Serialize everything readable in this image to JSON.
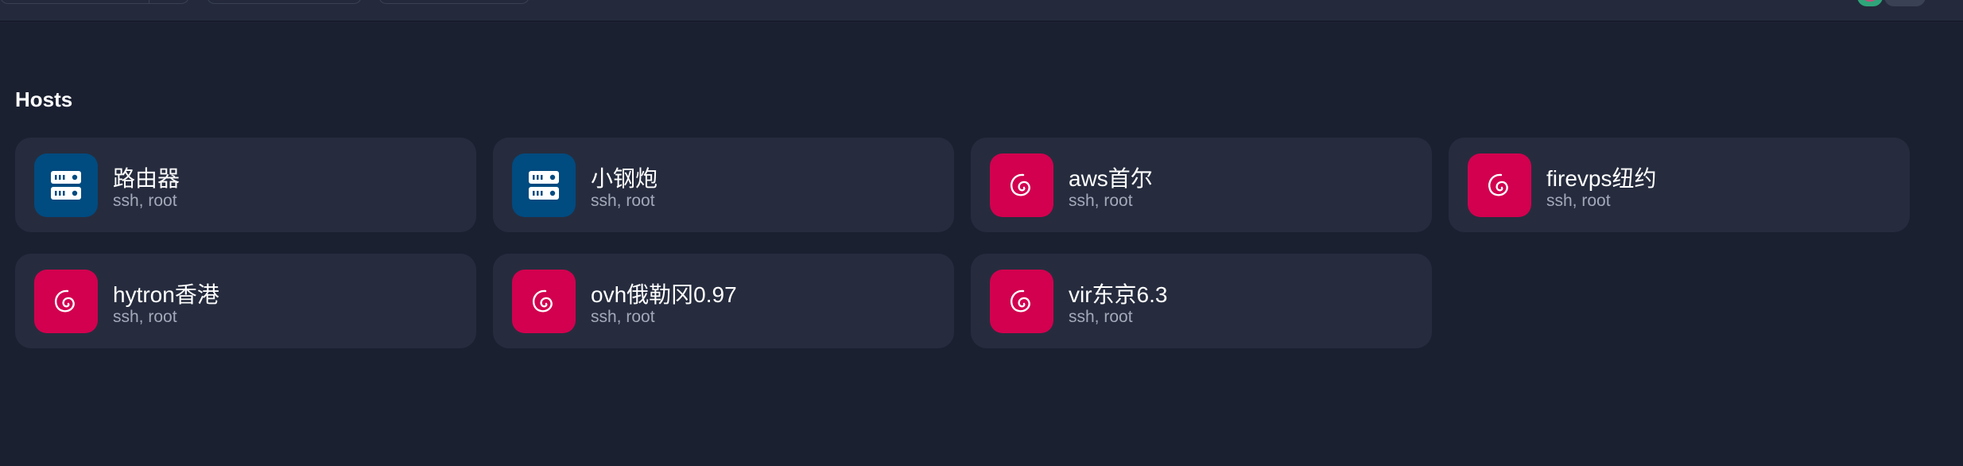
{
  "section": {
    "title": "Hosts"
  },
  "colors": {
    "background": "#1b2031",
    "card": "#262c3e",
    "server_icon_bg": "#004b80",
    "debian_icon_bg": "#d2004f",
    "subtext": "#a3a9b8"
  },
  "hosts": [
    {
      "name": "路由器",
      "subtitle": "ssh, root",
      "icon": "server-icon"
    },
    {
      "name": "小钢炮",
      "subtitle": "ssh, root",
      "icon": "server-icon"
    },
    {
      "name": "aws首尔",
      "subtitle": "ssh, root",
      "icon": "debian-icon"
    },
    {
      "name": "firevps纽约",
      "subtitle": "ssh, root",
      "icon": "debian-icon"
    },
    {
      "name": "hytron香港",
      "subtitle": "ssh, root",
      "icon": "debian-icon"
    },
    {
      "name": "ovh俄勒冈0.97",
      "subtitle": "ssh, root",
      "icon": "debian-icon"
    },
    {
      "name": "vir东京6.3",
      "subtitle": "ssh, root",
      "icon": "debian-icon"
    }
  ]
}
